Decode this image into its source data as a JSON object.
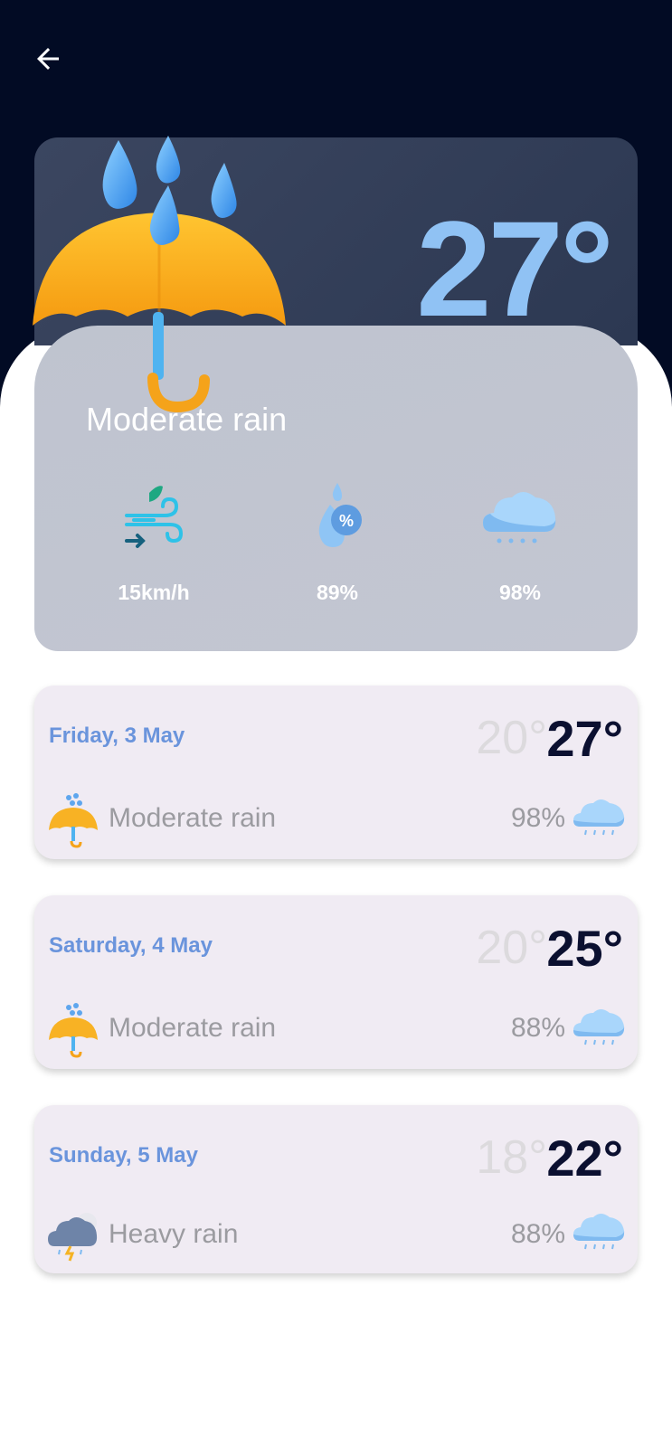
{
  "current": {
    "temperature": "27°",
    "condition": "Moderate rain",
    "stats": [
      {
        "icon": "wind-icon",
        "value": "15km/h"
      },
      {
        "icon": "humidity-icon",
        "value": "89%"
      },
      {
        "icon": "cloud-rain-icon",
        "value": "98%"
      }
    ]
  },
  "forecast": [
    {
      "date": "Friday, 3 May",
      "low": "20°",
      "high": "27°",
      "icon": "umbrella-rain-icon",
      "condition": "Moderate rain",
      "rain_chance": "98%"
    },
    {
      "date": "Saturday, 4 May",
      "low": "20°",
      "high": "25°",
      "icon": "umbrella-rain-icon",
      "condition": "Moderate rain",
      "rain_chance": "88%"
    },
    {
      "date": "Sunday, 5 May",
      "low": "18°",
      "high": "22°",
      "icon": "storm-cloud-icon",
      "condition": "Heavy rain",
      "rain_chance": "88%"
    }
  ],
  "colors": {
    "header_bg": "#020b24",
    "date_blue": "#6a94dc",
    "temp_blue": "#90c2f4",
    "card_bg": "#f0ebf3"
  }
}
